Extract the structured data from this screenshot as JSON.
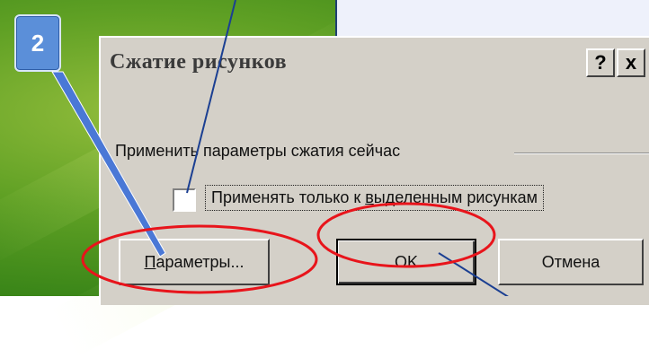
{
  "slide": {
    "step_number": "2",
    "background_color": "#5fa024",
    "callout_color": "#eef1fb"
  },
  "dialog": {
    "title": "Сжатие рисунков",
    "help_button": "?",
    "close_button": "x",
    "group_label": "Применить параметры сжатия сейчас",
    "checkbox": {
      "label_before": "Применять только к ",
      "label_mnemonic": "в",
      "label_after": "ыделенным рисункам",
      "checked": false
    },
    "buttons": {
      "params_mnemonic": "П",
      "params_rest": "араметры...",
      "ok": "OK",
      "cancel": "Отмена"
    }
  },
  "annotations": {
    "ellipse_color": "#e8141b",
    "pointer_color": "#2a55b5"
  }
}
